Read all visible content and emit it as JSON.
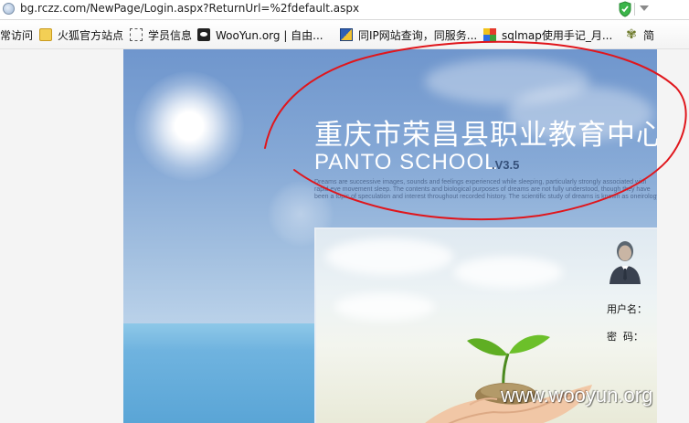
{
  "browser": {
    "url": "bg.rczz.com/NewPage/Login.aspx?ReturnUrl=%2fdefault.aspx",
    "bookmarks": [
      {
        "label": "常访问",
        "icon": "none"
      },
      {
        "label": "火狐官方站点",
        "icon": "folder-icon"
      },
      {
        "label": "学员信息",
        "icon": "dashed-page-icon"
      },
      {
        "label": "WooYun.org | 自由...",
        "icon": "wooyun-icon"
      },
      {
        "label": "同IP网站查询，同服务...",
        "icon": "ip-lookup-icon"
      },
      {
        "label": "sqlmap使用手记_月...",
        "icon": "sqlmap-icon"
      },
      {
        "label": "简",
        "icon": "leaf-icon"
      }
    ]
  },
  "page": {
    "school_name": "重庆市荣昌县职业教育中心",
    "brand": "PANTO SCHOOL",
    "version": ".V3.5",
    "tagline": "Dreams are successive images, sounds and feelings experienced while sleeping, particularly strongly associated with rapid eye movement sleep. The contents and biological purposes of dreams are not fully understood, though they have been a topic of speculation and interest throughout recorded history. The scientific study of dreams is known as oneirology.",
    "login": {
      "username_label": "用户名：",
      "password_label": "密  码："
    }
  },
  "watermark": "www.wooyun.org",
  "colors": {
    "sky_top": "#6f96cd",
    "sea": "#5aa5d6",
    "annotation_red": "#e0161c"
  }
}
